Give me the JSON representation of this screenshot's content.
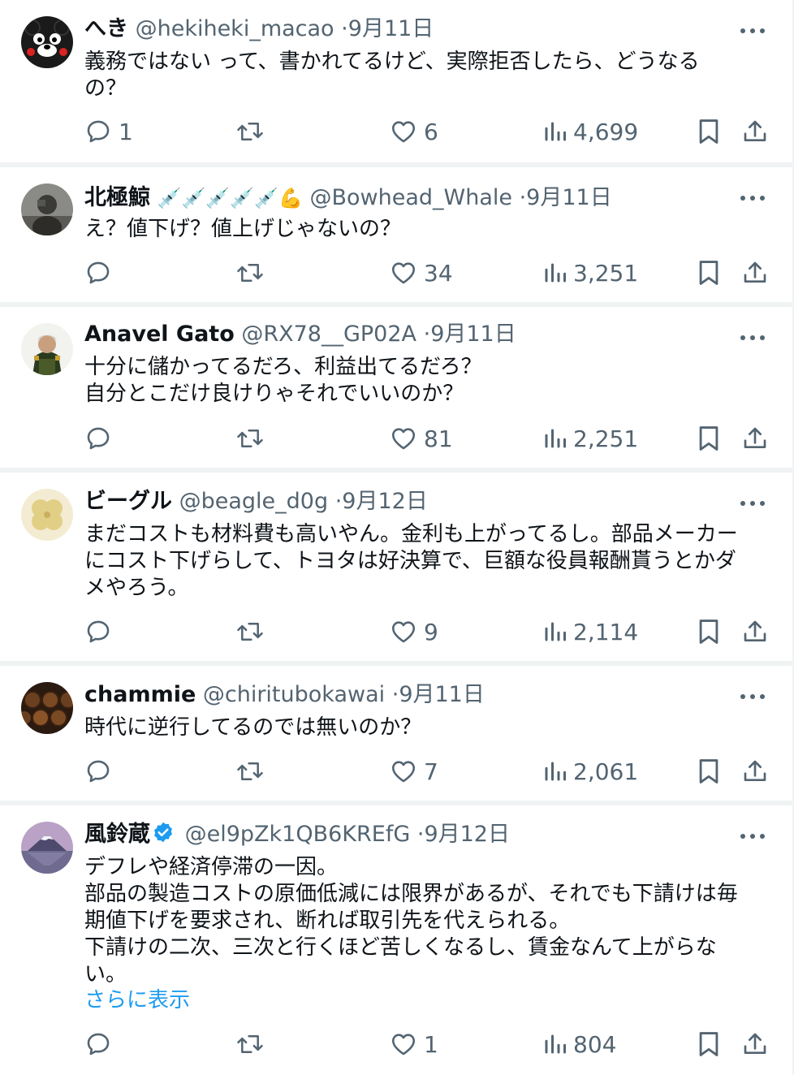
{
  "more_label": "···",
  "tweets": [
    {
      "name": "へき",
      "emoji": "",
      "handle": "@hekiheki_macao",
      "date": "9月11日",
      "body": "義務ではない って、書かれてるけど、実際拒否したら、どうなる\nの？",
      "replies": "1",
      "retweets": "",
      "likes": "6",
      "views": "4,699",
      "avatar_icon": "kumamon-avatar"
    },
    {
      "name": "北極鯨",
      "emoji": "💉💉💉💉💉💪",
      "handle": "@Bowhead_Whale",
      "date": "9月11日",
      "body": "え？値下げ？値上げじゃないの？",
      "replies": "",
      "retweets": "",
      "likes": "34",
      "views": "3,251",
      "avatar_icon": "photo-avatar"
    },
    {
      "name": "Anavel Gato",
      "emoji": "",
      "handle": "@RX78__GP02A",
      "date": "9月11日",
      "body": "十分に儲かってるだろ、利益出てるだろ？\n自分とこだけ良けりゃそれでいいのか？",
      "replies": "",
      "retweets": "",
      "likes": "81",
      "views": "2,251",
      "avatar_icon": "anime-character-avatar"
    },
    {
      "name": "ビーグル",
      "emoji": "",
      "handle": "@beagle_d0g",
      "date": "9月12日",
      "body": "まだコストも材料費も高いやん。金利も上がってるし。部品メーカー\nにコスト下げらして、トヨタは好決算で、巨額な役員報酬貰うとかダ\nメやろう。",
      "replies": "",
      "retweets": "",
      "likes": "9",
      "views": "2,114",
      "avatar_icon": "clover-avatar"
    },
    {
      "name": "chammie",
      "emoji": "",
      "handle": "@chiritubokawai",
      "date": "9月11日",
      "body": "時代に逆行してるのでは無いのか？",
      "replies": "",
      "retweets": "",
      "likes": "7",
      "views": "2,061",
      "avatar_icon": "barrels-avatar"
    },
    {
      "name": "風鈴蔵",
      "emoji": "",
      "handle": "@el9pZk1QB6KREfG",
      "date": "9月12日",
      "body": "デフレや経済停滞の一因。\n部品の製造コストの原価低減には限界があるが、それでも下請けは毎\n期値下げを要求され、断れば取引先を代えられる。\n下請けの二次、三次と行くほど苦しくなるし、賃金なんて上がらな\nい。",
      "show_more": "さらに表示",
      "verified": true,
      "replies": "",
      "retweets": "",
      "likes": "1",
      "views": "804",
      "avatar_icon": "mount-fuji-avatar"
    }
  ],
  "colors": {
    "text": "#0f1419",
    "muted": "#536471",
    "link": "#1d9bf0",
    "divider": "#eff3f4"
  }
}
